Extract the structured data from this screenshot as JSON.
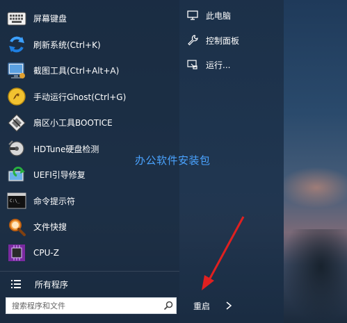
{
  "apps": [
    {
      "label": "屏幕键盘",
      "icon": "keyboard-icon"
    },
    {
      "label": "刷新系统(Ctrl+K)",
      "icon": "refresh-icon"
    },
    {
      "label": "截图工具(Ctrl+Alt+A)",
      "icon": "screenshot-icon"
    },
    {
      "label": "手动运行Ghost(Ctrl+G)",
      "icon": "ghost-icon"
    },
    {
      "label": "扇区小工具BOOTICE",
      "icon": "bootice-icon"
    },
    {
      "label": "HDTune硬盘检测",
      "icon": "hdtune-icon"
    },
    {
      "label": "UEFI引导修复",
      "icon": "uefi-repair-icon"
    },
    {
      "label": "命令提示符",
      "icon": "command-prompt-icon"
    },
    {
      "label": "文件快搜",
      "icon": "file-search-icon"
    },
    {
      "label": "CPU-Z",
      "icon": "cpu-z-icon"
    }
  ],
  "all_programs": {
    "label": "所有程序",
    "icon": "list-icon"
  },
  "search": {
    "placeholder": "搜索程序和文件",
    "icon": "search-icon"
  },
  "right_items": [
    {
      "label": "此电脑",
      "icon": "computer-icon"
    },
    {
      "label": "控制面板",
      "icon": "wrench-icon"
    },
    {
      "label": "运行...",
      "icon": "run-icon"
    }
  ],
  "restart": {
    "label": "重启",
    "icon": "chevron-right-icon"
  },
  "watermark": "办公软件安装包",
  "colors": {
    "accent": "#4aa3ff",
    "annotation_arrow": "#e02020",
    "menu_bg": "#1e3450"
  }
}
